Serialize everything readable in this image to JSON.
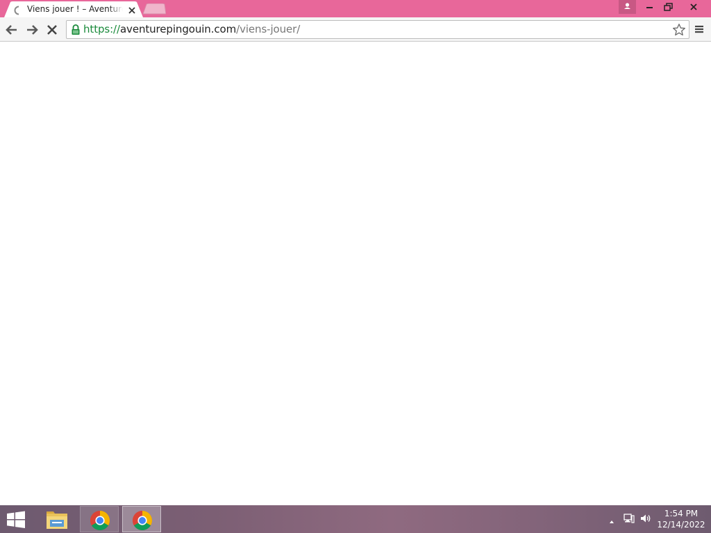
{
  "browser": {
    "tab": {
      "title": "Viens jouer ! – Aventure Pingouin",
      "loading": true
    },
    "url": {
      "scheme": "https://",
      "host": "aventurepingouin.com",
      "path": "/viens-jouer/"
    },
    "accent_color": "#e8679a"
  },
  "icons": {
    "tab_spinner": "loading-spinner-icon",
    "tab_close": "close-icon",
    "new_tab": "new-tab-icon",
    "profile": "profile-icon",
    "minimize": "minimize-icon",
    "restore": "restore-icon",
    "close": "close-icon",
    "back": "back-arrow-icon",
    "forward": "forward-arrow-icon",
    "stop": "stop-icon",
    "lock": "lock-icon",
    "bookmark": "star-icon",
    "menu": "hamburger-menu-icon"
  },
  "taskbar": {
    "apps": [
      "file-explorer",
      "chrome",
      "chrome"
    ],
    "clock": {
      "time": "1:54 PM",
      "date": "12/14/2022"
    }
  }
}
